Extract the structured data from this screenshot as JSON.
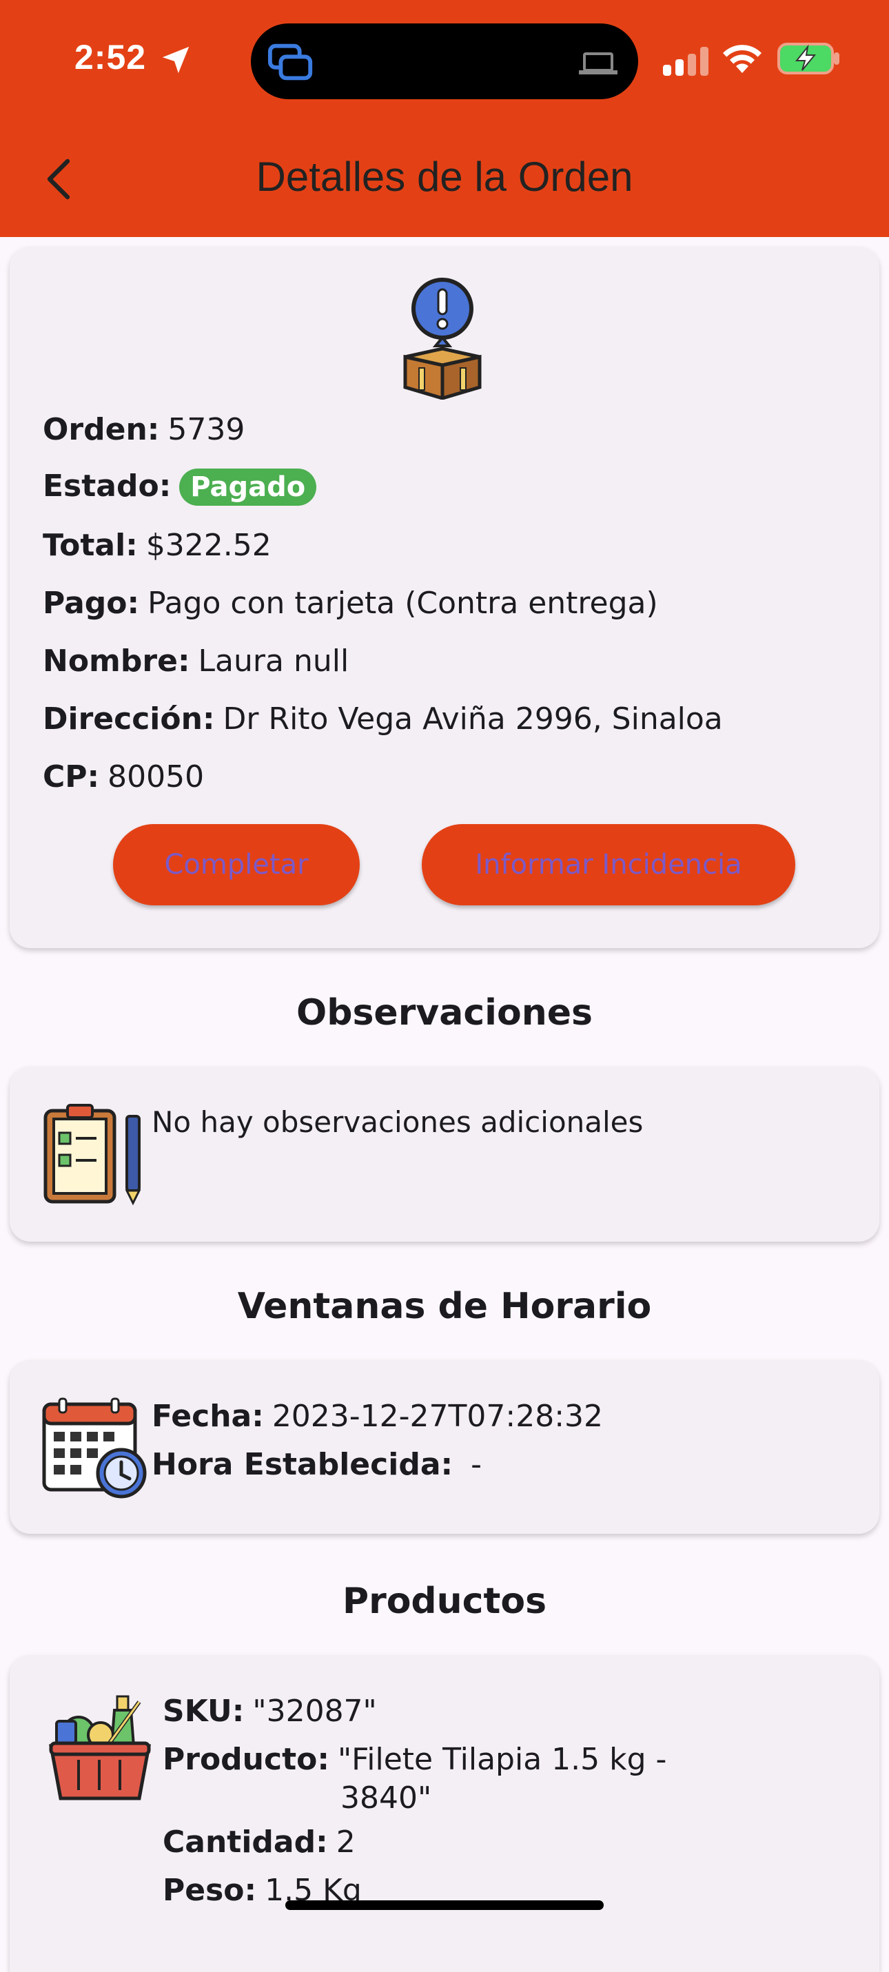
{
  "status_bar": {
    "time": "2:52"
  },
  "app_bar": {
    "title": "Detalles de la Orden"
  },
  "order": {
    "orden_label": "Orden:",
    "orden_value": "5739",
    "estado_label": "Estado:",
    "estado_value": "Pagado",
    "total_label": "Total:",
    "total_value": "$322.52",
    "pago_label": "Pago:",
    "pago_value": "Pago con tarjeta (Contra entrega)",
    "nombre_label": "Nombre:",
    "nombre_value": "Laura null",
    "direccion_label": "Dirección:",
    "direccion_value": "Dr Rito Vega Aviña 2996, Sinaloa",
    "cp_label": "CP:",
    "cp_value": "80050",
    "complete_button": "Completar",
    "incident_button": "Informar Incidencia"
  },
  "observaciones": {
    "title": "Observaciones",
    "text": "No hay observaciones adicionales"
  },
  "horario": {
    "title": "Ventanas de Horario",
    "fecha_label": "Fecha:",
    "fecha_value": "2023-12-27T07:28:32",
    "hora_label": "Hora Establecida:",
    "hora_value": "-"
  },
  "productos": {
    "title": "Productos",
    "items": [
      {
        "sku_label": "SKU:",
        "sku_value": "\"32087\"",
        "producto_label": "Producto:",
        "producto_line1": "\"Filete Tilapia 1.5 kg -",
        "producto_line2": "3840\"",
        "cantidad_label": "Cantidad:",
        "cantidad_value": "2",
        "peso_label": "Peso:",
        "peso_value": "1.5 Kg"
      }
    ]
  },
  "colors": {
    "brand": "#e34115",
    "status_paid": "#4caf50",
    "button_text": "#7b5ac9",
    "card_bg": "#f4eff5",
    "page_bg": "#fcf7fc"
  },
  "icons": [
    "location-arrow-icon",
    "screen-share-icon",
    "laptop-icon",
    "signal-icon",
    "wifi-icon",
    "battery-charging-icon",
    "back-chevron-icon",
    "order-box-alert-icon",
    "clipboard-checklist-icon",
    "calendar-clock-icon",
    "grocery-basket-icon"
  ]
}
